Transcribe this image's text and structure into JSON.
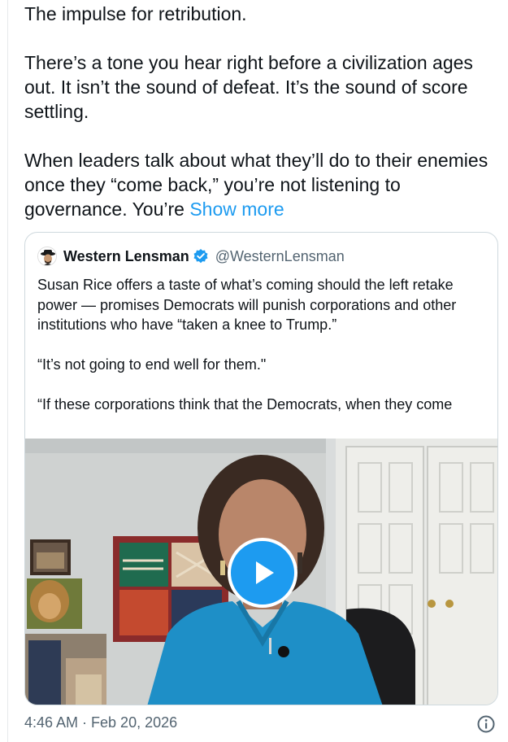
{
  "tweet": {
    "lines": [
      "The impulse for retribution.",
      "There’s a tone you hear right before a civilization ages out.  It isn’t the sound of defeat. It’s the sound of score settling.",
      "When leaders talk about what they’ll do to their enemies once they “come back,” you’re not listening to governance. You’re"
    ],
    "show_more": "Show more",
    "timestamp": "4:46 AM · Feb 20, 2026"
  },
  "quote": {
    "display_name": "Western Lensman",
    "handle": "@WesternLensman",
    "paragraphs": [
      "Susan Rice offers a taste of what’s coming should the left retake power — promises Democrats will punish corporations and other institutions who have “taken a knee to Trump.”",
      "“It’s not going to end well for them.\"",
      "“If these corporations think that the Democrats, when they come"
    ]
  },
  "icons": {
    "verified": "verified-badge-icon",
    "play": "play-icon",
    "info": "info-icon"
  },
  "colors": {
    "link": "#1d9bf0",
    "secondary_text": "#536471",
    "play_button": "#1d9bf0"
  }
}
